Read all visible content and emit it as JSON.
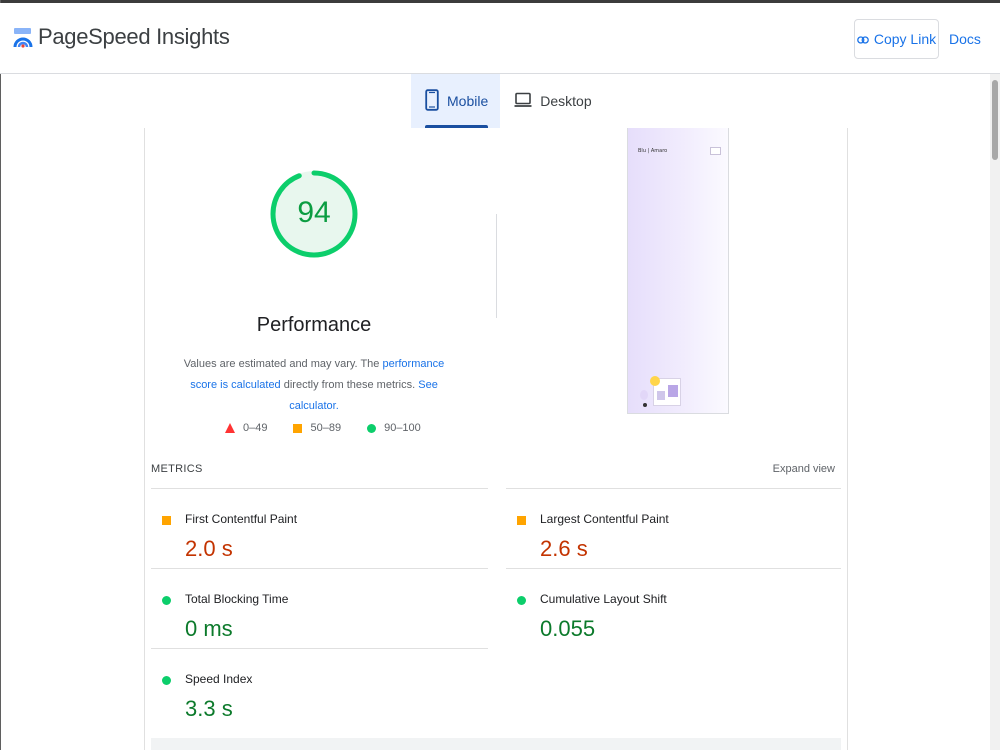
{
  "header": {
    "title": "PageSpeed Insights",
    "copy_link_label": "Copy Link",
    "docs_label": "Docs"
  },
  "tabs": [
    {
      "label": "Mobile",
      "active": true,
      "icon": "mobile-icon"
    },
    {
      "label": "Desktop",
      "active": false,
      "icon": "desktop-icon"
    }
  ],
  "performance": {
    "score": "94",
    "score_fraction": 0.94,
    "title": "Performance",
    "desc_part1": "Values are estimated and may vary. The ",
    "desc_link1": "performance score is calculated",
    "desc_part2": " directly from these metrics. ",
    "desc_link2": "See calculator."
  },
  "legend": [
    {
      "label": "0–49",
      "icon": "triangle-icon",
      "color": "#ff3333"
    },
    {
      "label": "50–89",
      "icon": "square-icon",
      "color": "#ffa400"
    },
    {
      "label": "90–100",
      "icon": "circle-icon",
      "color": "#0cce6b"
    }
  ],
  "screenshot": {
    "brand_text": "Blu | Amaro"
  },
  "metrics": {
    "section_label": "METRICS",
    "expand_label": "Expand view",
    "items": [
      {
        "name": "First Contentful Paint",
        "value": "2.0 s",
        "status": "average"
      },
      {
        "name": "Largest Contentful Paint",
        "value": "2.6 s",
        "status": "average"
      },
      {
        "name": "Total Blocking Time",
        "value": "0 ms",
        "status": "good"
      },
      {
        "name": "Cumulative Layout Shift",
        "value": "0.055",
        "status": "good"
      },
      {
        "name": "Speed Index",
        "value": "3.3 s",
        "status": "good"
      }
    ]
  },
  "colors": {
    "good": "#0cce6b",
    "average": "#ffa400",
    "poor": "#ff3333",
    "accent": "#1a73e8"
  }
}
